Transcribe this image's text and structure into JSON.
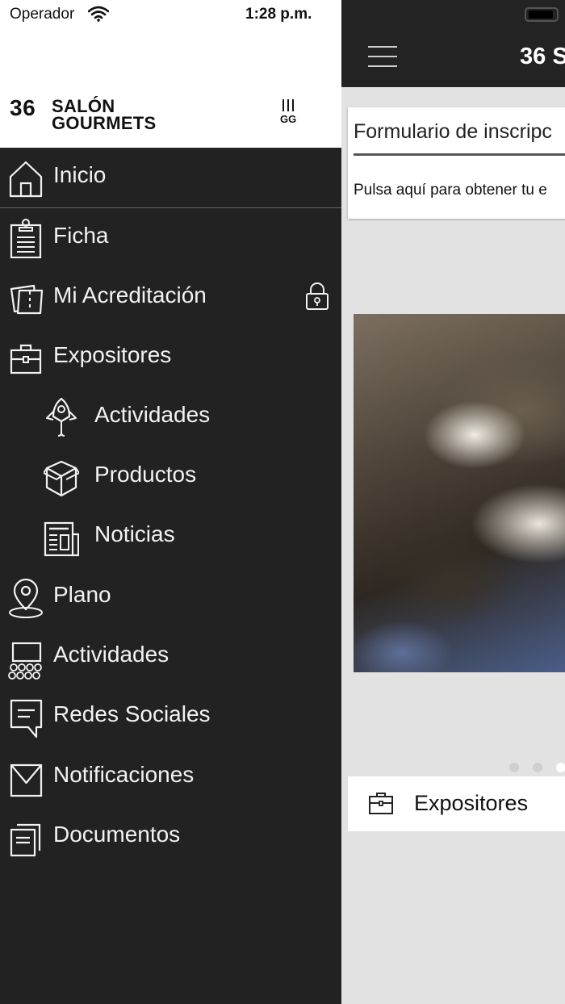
{
  "status_bar": {
    "carrier": "Operador",
    "time": "1:28 p.m."
  },
  "drawer": {
    "logo": {
      "number": "36",
      "line1": "SALÓN",
      "line2": "GOURMETS"
    },
    "menu": [
      {
        "label": "Inicio",
        "icon": "home-icon"
      },
      {
        "label": "Ficha",
        "icon": "clipboard-icon"
      },
      {
        "label": "Mi Acreditación",
        "icon": "tickets-icon",
        "locked": true
      },
      {
        "label": "Expositores",
        "icon": "briefcase-icon"
      },
      {
        "label": "Actividades",
        "icon": "rocket-icon",
        "sub": true
      },
      {
        "label": "Productos",
        "icon": "box-icon",
        "sub": true
      },
      {
        "label": "Noticias",
        "icon": "newspaper-icon",
        "sub": true
      },
      {
        "label": "Plano",
        "icon": "map-pin-icon"
      },
      {
        "label": "Actividades",
        "icon": "audience-icon"
      },
      {
        "label": "Redes Sociales",
        "icon": "chat-icon"
      },
      {
        "label": "Notificaciones",
        "icon": "envelope-icon"
      },
      {
        "label": "Documentos",
        "icon": "documents-icon"
      }
    ]
  },
  "main": {
    "title": "36 S",
    "form_card": {
      "title": "Formulario de inscripc",
      "text": "Pulsa aquí para obtener tu e"
    },
    "carousel": {
      "active_index": 2,
      "count": 3
    },
    "exhibitors_card": {
      "label": "Expositores"
    }
  },
  "colors": {
    "drawer_bg": "#232223",
    "topbar_bg": "#232323",
    "screen_bg": "#e2e2e2"
  }
}
